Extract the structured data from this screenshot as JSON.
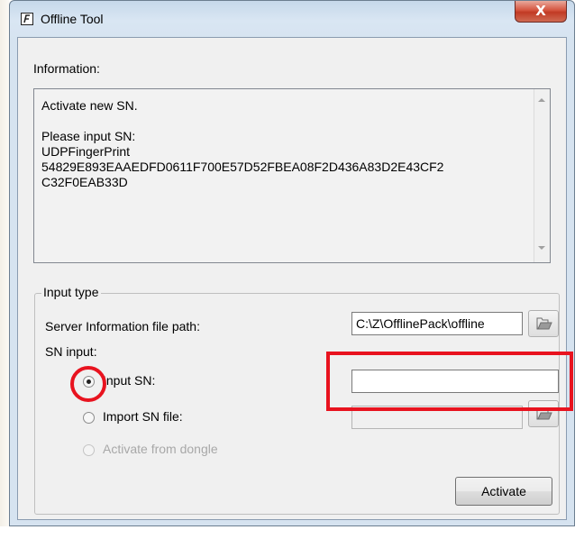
{
  "window": {
    "title": "Offline Tool",
    "close_label": "X"
  },
  "information": {
    "label": "Information:",
    "text": "Activate new SN.\n\nPlease input SN:\nUDPFingerPrint\n54829E893EAAEDFD0611F700E57D52FBEA08F2D436A83D2E43CF2\nC32F0EAB33D"
  },
  "input_type": {
    "group_label": "Input type",
    "server_info_label": "Server Information file path:",
    "server_info_value": "C:\\Z\\OfflinePack\\offline",
    "sn_input_label": "SN input:",
    "input_sn_label": "Input SN:",
    "input_sn_value": "",
    "import_sn_file_label": "Import SN file:",
    "import_sn_file_value": "",
    "activate_dongle_label": "Activate from dongle",
    "selected_option": "Input SN"
  },
  "buttons": {
    "activate_label": "Activate"
  },
  "icons": {
    "app": "app-icon",
    "close": "close-icon",
    "folder": "folder-open-icon"
  },
  "colors": {
    "highlight": "#e8131f",
    "close_button": "#c13a24",
    "title_bar": "#c6d8ea"
  }
}
